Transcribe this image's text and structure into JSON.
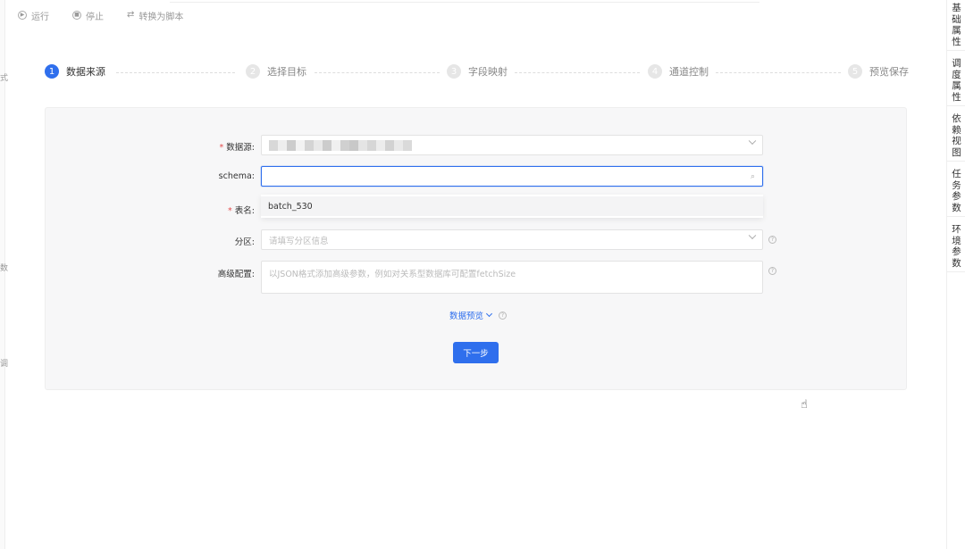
{
  "toolbar": {
    "items": [
      {
        "label": "运行",
        "icon": "play-circle-icon"
      },
      {
        "label": "停止",
        "icon": "stop-circle-icon"
      },
      {
        "label": "转换为脚本",
        "icon": "convert-icon"
      }
    ]
  },
  "left_fragments": [
    "式",
    "数",
    "调"
  ],
  "steps": [
    {
      "num": "1",
      "label": "数据来源"
    },
    {
      "num": "2",
      "label": "选择目标"
    },
    {
      "num": "3",
      "label": "字段映射"
    },
    {
      "num": "4",
      "label": "通道控制"
    },
    {
      "num": "5",
      "label": "预览保存"
    }
  ],
  "form": {
    "datasource": {
      "label": "数据源",
      "required": "*"
    },
    "schema": {
      "label": "schema",
      "value": "",
      "dropdown_item": "batch_530"
    },
    "table": {
      "label": "表名",
      "required": "*"
    },
    "partition": {
      "label": "分区",
      "placeholder": "请填写分区信息"
    },
    "advanced": {
      "label": "高级配置",
      "placeholder": "以JSON格式添加高级参数，例如对关系型数据库可配置fetchSize"
    },
    "colon": ":"
  },
  "preview_link": "数据预览",
  "next_button": "下一步",
  "right_tabs": [
    "基础属性",
    "调度属性",
    "依赖视图",
    "任务参数",
    "环境参数"
  ],
  "colors": {
    "accent": "#2f6fed",
    "required": "#e34d4d"
  }
}
